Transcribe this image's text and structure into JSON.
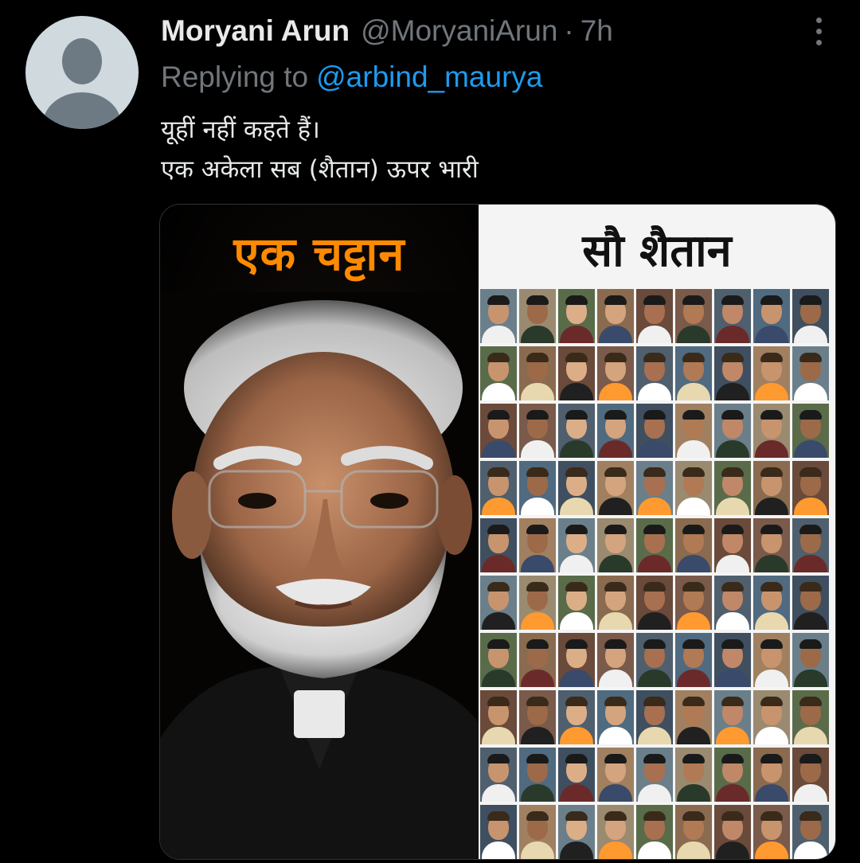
{
  "tweet": {
    "display_name": "Moryani Arun",
    "handle": "@MoryaniArun",
    "separator": "·",
    "time": "7h",
    "more_icon": "more-vertical-icon",
    "replying_prefix": "Replying to",
    "replying_to": "@arbind_maurya",
    "text_lines": [
      "यूहीं नहीं कहते हैं।",
      "एक अकेला सब (शैतान) ऊपर भारी"
    ]
  },
  "media": {
    "left_title": "एक चट्टान",
    "right_title": "सौ शैतान",
    "colors": {
      "left_title": "#ff8a00",
      "right_title": "#111111",
      "link": "#1d9bf0",
      "muted": "#71767b",
      "text": "#e7e9ea"
    },
    "grid": {
      "columns": 9,
      "rows": 10
    }
  }
}
